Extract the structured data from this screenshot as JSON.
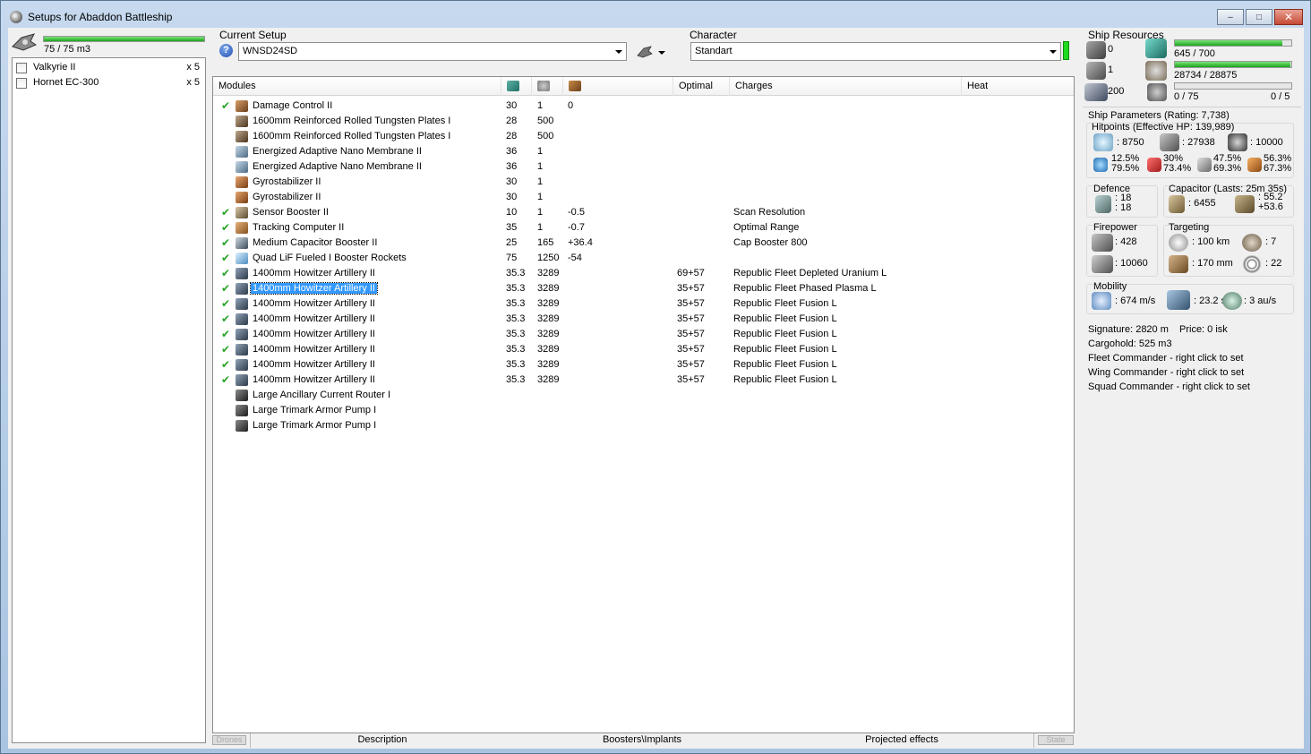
{
  "window": {
    "title": "Setups for Abaddon Battleship",
    "min": "–",
    "max": "□",
    "close": "✕"
  },
  "drone_bay": {
    "capacity_text": "75 / 75 m3",
    "fill_fraction": 1.0,
    "drones": [
      {
        "name": "Valkyrie II",
        "count": "x 5"
      },
      {
        "name": "Hornet EC-300",
        "count": "x 5"
      }
    ]
  },
  "setup": {
    "label": "Current Setup",
    "value": "WNSD24SD",
    "help": "?"
  },
  "character": {
    "label": "Character",
    "value": "Standart"
  },
  "modules": {
    "headers": {
      "name": "Modules",
      "optimal": "Optimal",
      "charges": "Charges",
      "heat": "Heat"
    },
    "rows": [
      {
        "check": "✔",
        "name": "Damage Control II",
        "cpu": "30",
        "pg": "1",
        "cap": "0",
        "optimal": "",
        "charge": "",
        "icon": "damage-control"
      },
      {
        "check": "",
        "name": "1600mm Reinforced Rolled Tungsten Plates I",
        "cpu": "28",
        "pg": "500",
        "cap": "",
        "optimal": "",
        "charge": "",
        "icon": "armor-plate"
      },
      {
        "check": "",
        "name": "1600mm Reinforced Rolled Tungsten Plates I",
        "cpu": "28",
        "pg": "500",
        "cap": "",
        "optimal": "",
        "charge": "",
        "icon": "armor-plate"
      },
      {
        "check": "",
        "name": "Energized Adaptive Nano Membrane II",
        "cpu": "36",
        "pg": "1",
        "cap": "",
        "optimal": "",
        "charge": "",
        "icon": "membrane"
      },
      {
        "check": "",
        "name": "Energized Adaptive Nano Membrane II",
        "cpu": "36",
        "pg": "1",
        "cap": "",
        "optimal": "",
        "charge": "",
        "icon": "membrane"
      },
      {
        "check": "",
        "name": "Gyrostabilizer II",
        "cpu": "30",
        "pg": "1",
        "cap": "",
        "optimal": "",
        "charge": "",
        "icon": "gyrostabilizer"
      },
      {
        "check": "",
        "name": "Gyrostabilizer II",
        "cpu": "30",
        "pg": "1",
        "cap": "",
        "optimal": "",
        "charge": "",
        "icon": "gyrostabilizer"
      },
      {
        "check": "✔",
        "name": "Sensor Booster II",
        "cpu": "10",
        "pg": "1",
        "cap": "-0.5",
        "optimal": "",
        "charge": "Scan Resolution",
        "icon": "sensor-booster"
      },
      {
        "check": "✔",
        "name": "Tracking Computer II",
        "cpu": "35",
        "pg": "1",
        "cap": "-0.7",
        "optimal": "",
        "charge": "Optimal Range",
        "icon": "tracking-computer"
      },
      {
        "check": "✔",
        "name": "Medium Capacitor Booster II",
        "cpu": "25",
        "pg": "165",
        "cap": "+36.4",
        "optimal": "",
        "charge": "Cap Booster 800",
        "icon": "capacitor-booster"
      },
      {
        "check": "✔",
        "name": "Quad LiF Fueled I Booster Rockets",
        "cpu": "75",
        "pg": "1250",
        "cap": "-54",
        "optimal": "",
        "charge": "",
        "icon": "microwarpdrive"
      },
      {
        "check": "✔",
        "name": "1400mm Howitzer Artillery II",
        "cpu": "35.3",
        "pg": "3289",
        "cap": "",
        "optimal": "69+57",
        "charge": "Republic Fleet Depleted Uranium L",
        "icon": "artillery"
      },
      {
        "check": "✔",
        "name": "1400mm Howitzer Artillery II",
        "cpu": "35.3",
        "pg": "3289",
        "cap": "",
        "optimal": "35+57",
        "charge": "Republic Fleet Phased Plasma L",
        "icon": "artillery",
        "selected": true
      },
      {
        "check": "✔",
        "name": "1400mm Howitzer Artillery II",
        "cpu": "35.3",
        "pg": "3289",
        "cap": "",
        "optimal": "35+57",
        "charge": "Republic Fleet Fusion L",
        "icon": "artillery"
      },
      {
        "check": "✔",
        "name": "1400mm Howitzer Artillery II",
        "cpu": "35.3",
        "pg": "3289",
        "cap": "",
        "optimal": "35+57",
        "charge": "Republic Fleet Fusion L",
        "icon": "artillery"
      },
      {
        "check": "✔",
        "name": "1400mm Howitzer Artillery II",
        "cpu": "35.3",
        "pg": "3289",
        "cap": "",
        "optimal": "35+57",
        "charge": "Republic Fleet Fusion L",
        "icon": "artillery"
      },
      {
        "check": "✔",
        "name": "1400mm Howitzer Artillery II",
        "cpu": "35.3",
        "pg": "3289",
        "cap": "",
        "optimal": "35+57",
        "charge": "Republic Fleet Fusion L",
        "icon": "artillery"
      },
      {
        "check": "✔",
        "name": "1400mm Howitzer Artillery II",
        "cpu": "35.3",
        "pg": "3289",
        "cap": "",
        "optimal": "35+57",
        "charge": "Republic Fleet Fusion L",
        "icon": "artillery"
      },
      {
        "check": "✔",
        "name": "1400mm Howitzer Artillery II",
        "cpu": "35.3",
        "pg": "3289",
        "cap": "",
        "optimal": "35+57",
        "charge": "Republic Fleet Fusion L",
        "icon": "artillery"
      },
      {
        "check": "",
        "name": "Large Ancillary Current Router I",
        "cpu": "",
        "pg": "",
        "cap": "",
        "optimal": "",
        "charge": "",
        "icon": "rig"
      },
      {
        "check": "",
        "name": "Large Trimark Armor Pump I",
        "cpu": "",
        "pg": "",
        "cap": "",
        "optimal": "",
        "charge": "",
        "icon": "rig"
      },
      {
        "check": "",
        "name": "Large Trimark Armor Pump I",
        "cpu": "",
        "pg": "",
        "cap": "",
        "optimal": "",
        "charge": "",
        "icon": "rig"
      }
    ]
  },
  "bottom_tabs": {
    "left_btn": "Drones",
    "description": "Description",
    "boosters": "Boosters\\Implants",
    "projected": "Projected effects",
    "right_btn": "State"
  },
  "resources": {
    "title": "Ship Resources",
    "turret_hardpoints": "0",
    "launcher_hardpoints": "1",
    "calibration": "200",
    "cpu_text": "645 / 700",
    "cpu_fraction": 0.921,
    "powergrid_text": "28734 / 28875",
    "powergrid_fraction": 0.995,
    "drone_bw_text": "0 / 75",
    "drone_ctl_text": "0 / 5",
    "drone_bw_fraction": 0
  },
  "params": {
    "title": "Ship Parameters (Rating: 7,738)",
    "hitpoints_title": "Hitpoints (Effective HP: 139,989)",
    "shield_hp": ": 8750",
    "armor_hp": ": 27938",
    "structure_hp": ": 10000",
    "res_em_1": "12.5%",
    "res_em_2": "79.5%",
    "res_th_1": "30%",
    "res_th_2": "73.4%",
    "res_ki_1": "47.5%",
    "res_ki_2": "69.3%",
    "res_ex_1": "56.3%",
    "res_ex_2": "67.3%",
    "defence_title": "Defence",
    "defence_1": ": 18",
    "defence_2": ": 18",
    "capacitor_title": "Capacitor (Lasts: 25m 35s)",
    "cap_amount": ": 6455",
    "cap_1": ": 55.2",
    "cap_2": "+53.6",
    "firepower_title": "Firepower",
    "fp_turret": ": 428",
    "fp_volley": ": 10060",
    "targeting_title": "Targeting",
    "target_range": ": 100 km",
    "max_targets": ": 7",
    "scan_res": ": 170 mm",
    "sensor_strength": ": 22",
    "mobility_title": "Mobility",
    "speed": ": 674 m/s",
    "align": ": 23.2 s",
    "warp": ": 3 au/s",
    "signature": "Signature: 2820 m",
    "price": "Price: 0 isk",
    "cargohold": "Cargohold: 525 m3",
    "fleet_cmd": "Fleet Commander - right click to set",
    "wing_cmd": "Wing Commander - right click to set",
    "squad_cmd": "Squad Commander - right click to set"
  },
  "colors": {
    "accent_green": "#1aa51a",
    "selection_blue": "#3399ff",
    "check_green": "#27a427"
  }
}
